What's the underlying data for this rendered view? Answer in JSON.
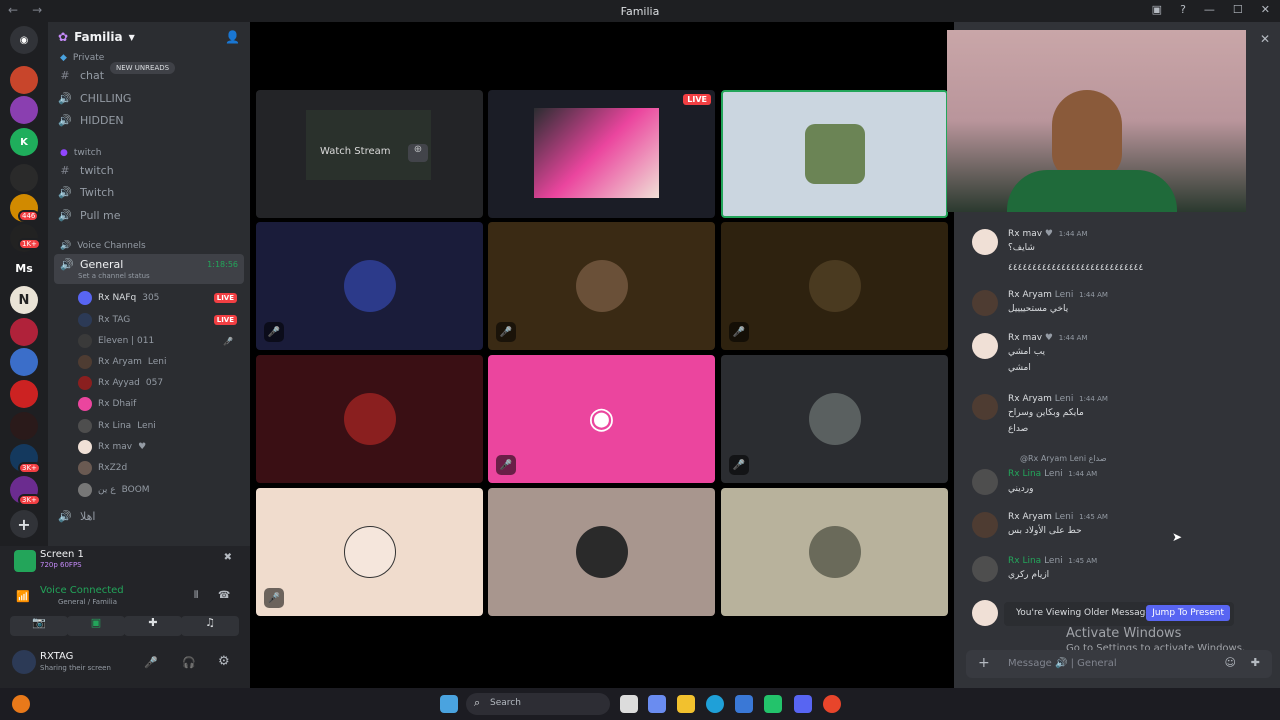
{
  "window": {
    "title": "Familia"
  },
  "server": {
    "name": "Familia",
    "new_unreads": "NEW UNREADS",
    "badges": [
      "446",
      "1K+",
      "3K+",
      "3K+"
    ],
    "ms_label": "Ms",
    "n_label": "N"
  },
  "channels": {
    "private_cat": "Private",
    "chat": "chat",
    "chilling": "CHILLING",
    "hidden": "HIDDEN",
    "twitch_cat": "twitch",
    "twitch1": "twitch",
    "twitch2": "Twitch",
    "pullme": "Pull me",
    "voice_cat": "Voice Channels",
    "general": "General",
    "general_timer": "1:18:56",
    "channel_status": "Set a channel status",
    "last_channel": "اهلا",
    "voice_users": [
      {
        "name": "Rx NAFq",
        "tag": "305",
        "live": "LIVE"
      },
      {
        "name": "Rx TAG",
        "live": "LIVE"
      },
      {
        "name": "Eleven | 011"
      },
      {
        "name": "Rx Aryam",
        "tag": "Leni"
      },
      {
        "name": "Rx Ayyad",
        "tag": "057"
      },
      {
        "name": "Rx Dhaif"
      },
      {
        "name": "Rx Lina",
        "tag": "Leni"
      },
      {
        "name": "Rx mav"
      },
      {
        "name": "RxZ2d"
      },
      {
        "name": "ع ين",
        "tag": "BOOM"
      }
    ]
  },
  "panel": {
    "screen_title": "Screen 1",
    "screen_sub": "720p 60FPS",
    "voice_connected": "Voice Connected",
    "voice_location": "General / Familia",
    "username": "RXTAG",
    "user_status": "Sharing their screen"
  },
  "stage": {
    "watch_stream": "Watch Stream",
    "live": "LIVE"
  },
  "chat": {
    "messages": [
      {
        "user": "Rx mav",
        "time": "1:44 AM",
        "lines": [
          "شايف؟",
          "٤٤٤٤٤٤٤٤٤٤٤٤٤٤٤٤٤٤٤٤٤٤٤٤٤٤٤٤"
        ]
      },
      {
        "user": "Rx Aryam",
        "tag": "Leni",
        "time": "1:44 AM",
        "lines": [
          "ياخي مستحييييل"
        ]
      },
      {
        "user": "Rx mav",
        "time": "1:44 AM",
        "lines": [
          "يب امشي",
          "امشي"
        ]
      },
      {
        "user": "Rx Aryam",
        "tag": "Leni",
        "time": "1:44 AM",
        "lines": [
          "مايكم وبكاين وسراح",
          "صداع"
        ]
      },
      {
        "user": "Rx Lina",
        "tag": "Leni",
        "time": "1:44 AM",
        "lines": [
          "ورديني"
        ],
        "reply": "@Rx Aryam  Leni  صداع"
      },
      {
        "user": "Rx Aryam",
        "tag": "Leni",
        "time": "1:45 AM",
        "lines": [
          "حط على الأولاد بس"
        ]
      },
      {
        "user": "Rx Lina",
        "tag": "Leni",
        "time": "1:45 AM",
        "lines": [
          "ازيام ركري"
        ]
      }
    ],
    "older_notice": "You're Viewing Older Messages",
    "jump_button": "Jump To Present",
    "placeholder": "Message  🔊 | General",
    "activate_title": "Activate Windows",
    "activate_sub": "Go to Settings to activate Windows."
  },
  "taskbar": {
    "search": "Search"
  }
}
